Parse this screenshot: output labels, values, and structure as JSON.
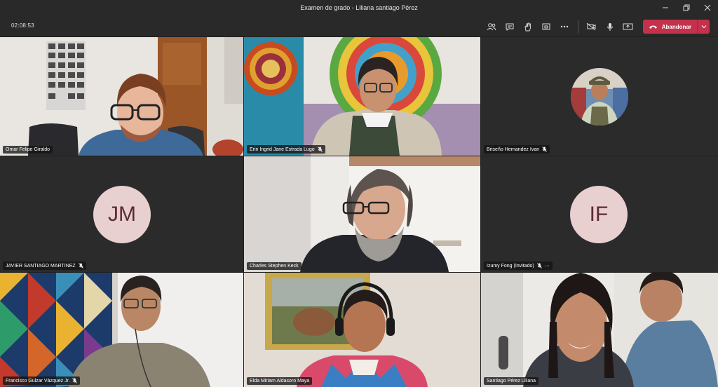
{
  "window": {
    "title": "Examen de grado - Liliana santiago Pérez"
  },
  "toolbar": {
    "timer": "02:08:53",
    "leave_label": "Abandonar"
  },
  "participants": [
    {
      "name": "Omar Felipe Giraldo",
      "muted": false
    },
    {
      "name": "Erin Ingrid Jane Estrada Lugo",
      "muted": true
    },
    {
      "name": "Briseño Hernandez Ivan",
      "muted": true
    },
    {
      "name": "JAVIER SANTIAGO MARTINEZ",
      "muted": true,
      "initials": "JM"
    },
    {
      "name": "Charles Stephen Keck",
      "muted": false
    },
    {
      "name": "Izumy Fong (Invitado)",
      "muted": true,
      "initials": "IF",
      "more": "···"
    },
    {
      "name": "Francisco Gulzar Vázquez Jr.",
      "muted": true
    },
    {
      "name": "Elda Miriam Aldasoro Maya",
      "muted": false
    },
    {
      "name": "Santiago Pérez Liliana",
      "muted": false
    }
  ],
  "colors": {
    "leave": "#c4314b",
    "avatar_bg": "#e8cfd0",
    "avatar_text": "#5e2a36"
  },
  "icons": [
    "people-icon",
    "chat-icon",
    "raise-hand-icon",
    "share-tray-icon",
    "more-icon",
    "camera-off-icon",
    "mic-icon",
    "share-screen-icon",
    "phone-hangup-icon"
  ]
}
